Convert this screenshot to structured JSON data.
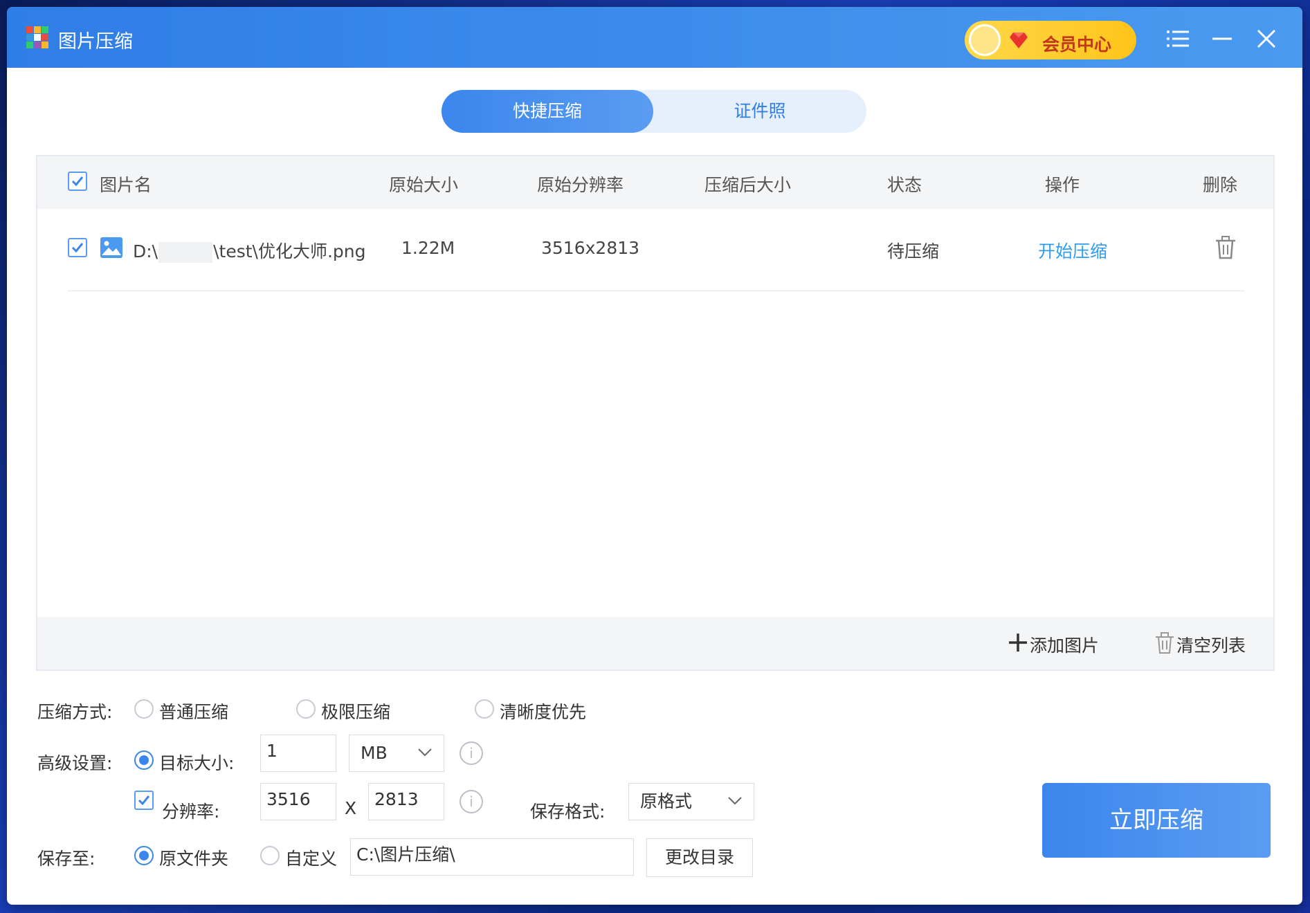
{
  "window": {
    "title": "图片压缩",
    "vip_label": "会员中心"
  },
  "tabs": {
    "active": "快捷压缩",
    "inactive": "证件照"
  },
  "table": {
    "headers": [
      "图片名",
      "原始大小",
      "原始分辨率",
      "压缩后大小",
      "状态",
      "操作",
      "删除"
    ],
    "rows": [
      {
        "checked": true,
        "name_prefix": "D:\\",
        "name_suffix": "\\test\\优化大师.png",
        "size": "1.22M",
        "resolution": "3516x2813",
        "compressed_size": "",
        "status": "待压缩",
        "action": "开始压缩"
      }
    ],
    "add_label": "添加图片",
    "clear_label": "清空列表"
  },
  "settings": {
    "mode_label": "压缩方式:",
    "modes": [
      "普通压缩",
      "极限压缩",
      "清晰度优先"
    ],
    "advanced_label": "高级设置:",
    "target_label": "目标大小:",
    "target_value": "1",
    "target_unit": "MB",
    "resolution_label": "分辨率:",
    "res_width": "3516",
    "res_x": "X",
    "res_height": "2813",
    "format_label": "保存格式:",
    "format_value": "原格式",
    "save_label": "保存至:",
    "save_original": "原文件夹",
    "save_custom": "自定义",
    "save_path": "C:\\图片压缩\\",
    "change_dir": "更改目录",
    "compress_now": "立即压缩"
  },
  "colors": {
    "accent": "#3b86ec",
    "titlebar": "#2f7de6",
    "link": "#2f9cf0"
  }
}
